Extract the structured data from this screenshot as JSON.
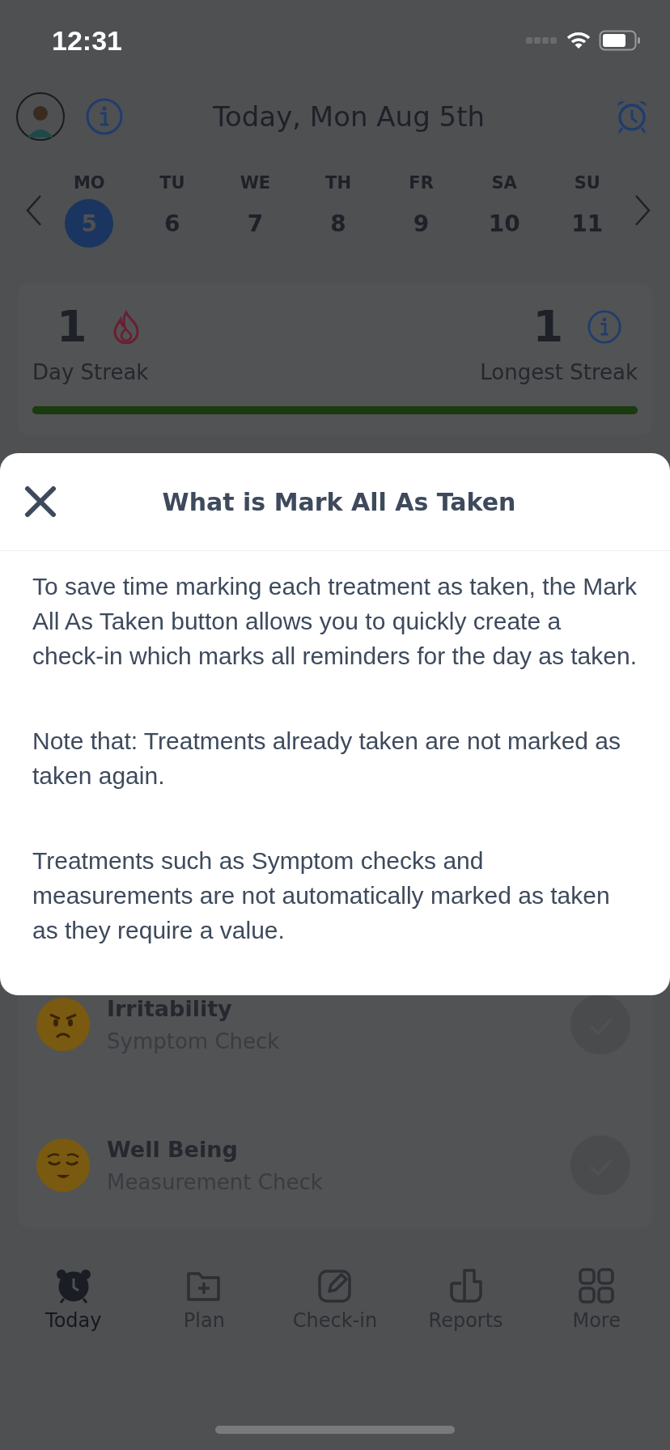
{
  "status_bar": {
    "time": "12:31"
  },
  "header": {
    "title": "Today, Mon Aug 5th"
  },
  "week": [
    {
      "day": "MO",
      "date": "5",
      "selected": true
    },
    {
      "day": "TU",
      "date": "6",
      "selected": false
    },
    {
      "day": "WE",
      "date": "7",
      "selected": false
    },
    {
      "day": "TH",
      "date": "8",
      "selected": false
    },
    {
      "day": "FR",
      "date": "9",
      "selected": false
    },
    {
      "day": "SA",
      "date": "10",
      "selected": false
    },
    {
      "day": "SU",
      "date": "11",
      "selected": false
    }
  ],
  "streak": {
    "current": "1",
    "current_label": "Day Streak",
    "longest": "1",
    "longest_label": "Longest Streak",
    "level": 1
  },
  "reminders": [
    {
      "name": "Irritability",
      "type": "Symptom Check",
      "checked": false
    },
    {
      "name": "Well Being",
      "type": "Measurement Check",
      "checked": false
    }
  ],
  "modal": {
    "title": "What is Mark All As Taken",
    "paragraphs": [
      "To save time marking each treatment as taken, the Mark All As Taken button allows you to quickly create a check-in which marks all reminders for the day as taken.",
      "Note that: Treatments already taken are not marked as taken again.",
      "Treatments such as Symptom checks and measurements are not automatically marked as taken as they require a value."
    ]
  },
  "tab_bar": [
    {
      "label": "Today",
      "selected": true
    },
    {
      "label": "Plan",
      "selected": false
    },
    {
      "label": "Check-in",
      "selected": false
    },
    {
      "label": "Reports",
      "selected": false
    },
    {
      "label": "More",
      "selected": false
    }
  ]
}
